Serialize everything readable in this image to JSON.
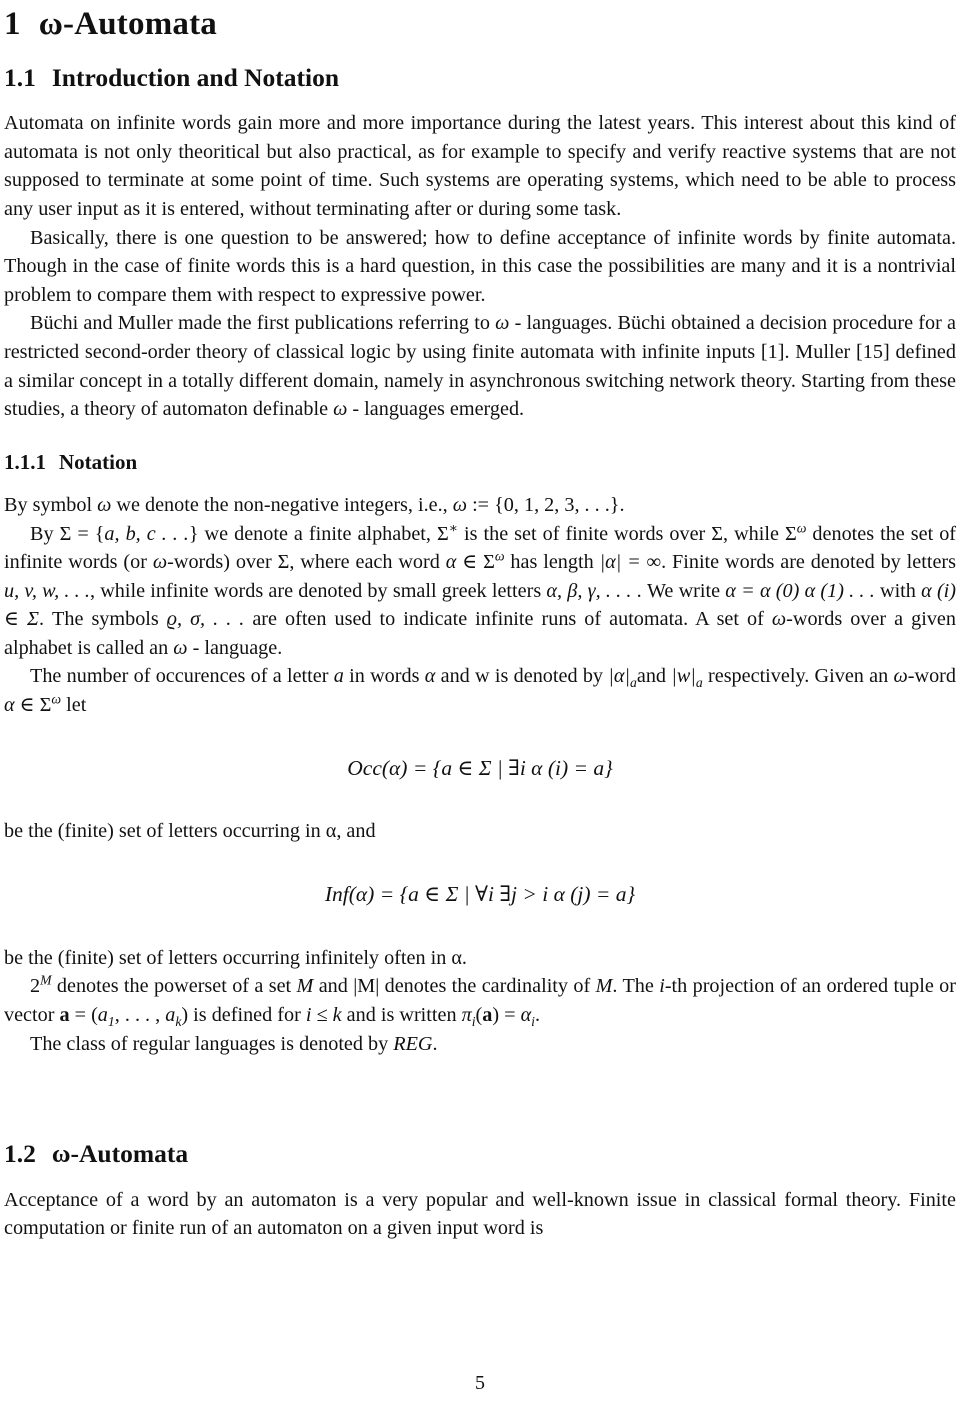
{
  "document": {
    "page_number": "5",
    "section": {
      "number": "1",
      "title": "ω-Automata"
    },
    "subsection_1_1": {
      "number": "1.1",
      "title": "Introduction and Notation"
    },
    "subsubsection_1_1_1": {
      "number": "1.1.1",
      "title": "Notation"
    },
    "subsection_1_2": {
      "number": "1.2",
      "title": "ω-Automata"
    },
    "paragraphs": {
      "intro_p1": "Automata on infinite words gain more and more importance during the latest years.  This interest about this kind of automata is not only theoritical but also practical, as for example to specify and verify reactive systems that are not supposed to terminate at some point of time.  Such systems are operating systems, which need to be able to process any user input as it is entered, without terminating after or during some task.",
      "intro_p2": "Basically, there is one question to be answered; how to define acceptance of infinite words by finite automata.  Though in the case of finite words this is a hard question, in this case the possibilities are many and it is a nontrivial problem to compare them with respect to expressive power.",
      "intro_p3_a": "Büchi and Muller made the first publications referring to ",
      "intro_p3_omega": "ω",
      "intro_p3_b": " - languages.  Büchi obtained a decision procedure for a restricted second-order theory of classical logic by using finite automata with infinite inputs [1].  Muller [15] defined a similar concept in a totally different domain, namely in asynchronous switching network theory.  Starting from these studies, a theory of automaton definable ",
      "intro_p3_c": " - languages emerged.",
      "notation_l1_a": "By symbol ",
      "notation_l1_b": " we denote the non-negative integers, i.e., ",
      "notation_l1_set": ":= {0, 1, 2, 3, . . .}.",
      "notation_l2_a": "By ",
      "notation_l2_sigma": "Σ",
      "notation_l2_b": " = {",
      "notation_l2_letters": "a, b, c . . .",
      "notation_l2_c": "} we denote a finite alphabet, ",
      "notation_l2_d": " is the set of finite words over ",
      "notation_l2_e": ", while ",
      "notation_l2_f": " denotes the set of infinite words (or ",
      "notation_l2_g": "-words) over ",
      "notation_l2_h": ", where each word ",
      "notation_l2_i": " has length ",
      "notation_l2_abs": "|α| = ∞",
      "notation_l2_j": ".  Finite words are denoted by letters ",
      "notation_l2_uvw": "u, v, w, . . .",
      "notation_l2_k": ", while infinite words are denoted by small greek letters ",
      "notation_l2_greek": "α, β, γ, . . .",
      "notation_l2_l": " .  We write ",
      "notation_l2_alphaeq": "α = α (0) α (1) . . .",
      "notation_l2_m": " with ",
      "notation_l2_alphai": "α (i) ∈ Σ",
      "notation_l2_n": ".  The symbols ",
      "notation_l2_rhosigma": "ϱ, σ, . . .",
      "notation_l2_o": " are often used to indicate infinite runs of automata.  A set of ",
      "notation_l2_p": "-words over a given alphabet is called an ",
      "notation_l2_q": " - language.",
      "occ_para_a": "The number of occurences of a letter ",
      "occ_para_a_letter": "a",
      "occ_para_b": " in words ",
      "occ_para_alpha": "α",
      "occ_para_c": " and w is denoted by ",
      "occ_para_abs1": "|α|",
      "occ_para_sub1": "a",
      "occ_para_d": "and ",
      "occ_para_abs2": "|w|",
      "occ_para_sub2": "a",
      "occ_para_e": " respectively.  Given an ",
      "occ_para_f": "-word  ",
      "occ_para_g": " let",
      "after_occ": "be the (finite) set of letters occurring in α, and",
      "after_inf": "be the (finite) set of letters occurring infinitely often in α.",
      "powerset_a": "2",
      "powerset_M": "M",
      "powerset_b": " denotes the powerset of a set  ",
      "powerset_c": " and |M| denotes the cardinality of ",
      "powerset_d": ".  The ",
      "powerset_ith": "i",
      "powerset_e": "-th projection of an ordered tuple or vector ",
      "powerset_vec": "a",
      "powerset_f": " = (",
      "powerset_tuple": "a",
      "powerset_g": ", . . . , ",
      "powerset_ak": "a",
      "powerset_h": ") is defined for ",
      "powerset_ik": "i ≤ k",
      "powerset_i": " and is written ",
      "powerset_pi": "π",
      "powerset_j": "(",
      "powerset_k": ") = ",
      "powerset_alphai": "α",
      "powerset_end": ".",
      "reg_line_a": "The class of regular languages is denoted by ",
      "reg_line_reg": "REG",
      "reg_line_b": ".",
      "automata_p1": "Acceptance of a word by an automaton is a very popular and well-known issue in classical formal theory.  Finite computation or finite run  of an automaton on  a given input word is"
    },
    "equations": {
      "occ": {
        "lhs": "Occ(α)",
        "eq": "=",
        "rhs": "{a ∈ Σ | ∃i α (i) = a}",
        "full": "Occ(α) = {a ∈ Σ | ∃i α (i) = a}"
      },
      "inf": {
        "lhs": "Inf(α)",
        "eq": "=",
        "rhs": "{a ∈ Σ | ∀i ∃j > i α (j) = a}",
        "full": "Inf(α) = {a ∈ Σ | ∀i ∃j > i α (j) = a}"
      }
    },
    "colors": {
      "page_background": "#ffffff",
      "text": "#111111"
    }
  }
}
